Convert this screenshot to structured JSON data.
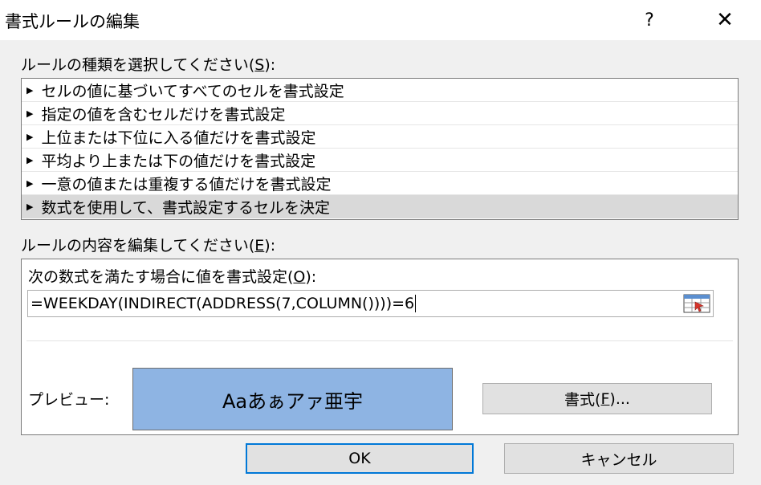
{
  "window": {
    "title": "書式ルールの編集",
    "help_label": "?",
    "close_label": "✕"
  },
  "rule_type": {
    "label": "ルールの種類を選択してください(",
    "accel": "S",
    "label_end": "):",
    "selected_index": 5,
    "items": [
      "セルの値に基づいてすべてのセルを書式設定",
      "指定の値を含むセルだけを書式設定",
      "上位または下位に入る値だけを書式設定",
      "平均より上または下の値だけを書式設定",
      "一意の値または重複する値だけを書式設定",
      "数式を使用して、書式設定するセルを決定"
    ]
  },
  "rule_edit": {
    "label": "ルールの内容を編集してください(",
    "accel": "E",
    "label_end": "):",
    "formula_label": "次の数式を満たす場合に値を書式設定(",
    "formula_accel": "O",
    "formula_label_end": "):",
    "formula_value": "=WEEKDAY(INDIRECT(ADDRESS(7,COLUMN())))=6",
    "ref_icon": "range-selector-icon",
    "preview_label": "プレビュー:",
    "preview_text": "Aaあぁアァ亜宇",
    "preview_color": "#8eb4e3",
    "format_label": "書式(",
    "format_accel": "F",
    "format_label_end": ")..."
  },
  "buttons": {
    "ok": "OK",
    "cancel": "キャンセル",
    "default_border_color": "#0078d7"
  }
}
